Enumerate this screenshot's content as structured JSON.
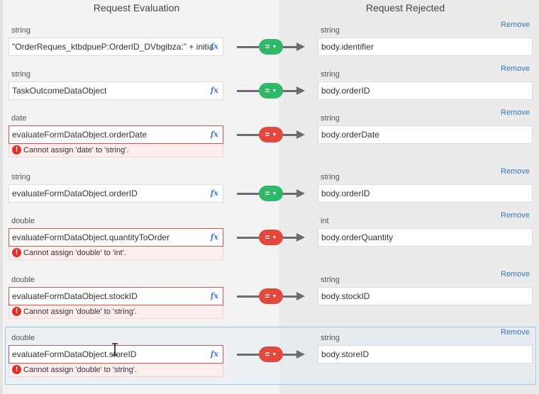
{
  "headers": {
    "left": "Request Evaluation",
    "right": "Request Rejected"
  },
  "remove_label": "Remove",
  "fx_label": "fx",
  "colors": {
    "ok": "#2fb868",
    "error": "#e4473c",
    "link": "#3a76b7",
    "fx": "#4a7fc4"
  },
  "rows": [
    {
      "source_type": "string",
      "source_value": "\"OrderReques_ktbdpueP:OrderID_DVbgibza:\" + initia",
      "status": "ok",
      "operator": "=",
      "target_type": "string",
      "target_value": "body.identifier",
      "error": ""
    },
    {
      "source_type": "string",
      "source_value": "TaskOutcomeDataObject",
      "status": "ok",
      "operator": "=",
      "target_type": "string",
      "target_value": "body.orderID",
      "error": ""
    },
    {
      "source_type": "date",
      "source_value": "evaluateFormDataObject.orderDate",
      "status": "error",
      "operator": "=",
      "target_type": "string",
      "target_value": "body.orderDate",
      "error": "Cannot assign 'date' to 'string'."
    },
    {
      "source_type": "string",
      "source_value": "evaluateFormDataObject.orderID",
      "status": "ok",
      "operator": "=",
      "target_type": "string",
      "target_value": "body.orderID",
      "error": ""
    },
    {
      "source_type": "double",
      "source_value": "evaluateFormDataObject.quantityToOrder",
      "status": "error",
      "operator": "=",
      "target_type": "int",
      "target_value": "body.orderQuantity",
      "error": "Cannot assign 'double' to 'int'."
    },
    {
      "source_type": "double",
      "source_value": "evaluateFormDataObject.stockID",
      "status": "error",
      "operator": "=",
      "target_type": "string",
      "target_value": "body.stockID",
      "error": "Cannot assign 'double' to 'string'."
    },
    {
      "source_type": "double",
      "source_value": "evaluateFormDataObject.storeID",
      "status": "error",
      "operator": "=",
      "target_type": "string",
      "target_value": "body.storeID",
      "error": "Cannot assign 'double' to 'string'.",
      "selected": true
    }
  ]
}
